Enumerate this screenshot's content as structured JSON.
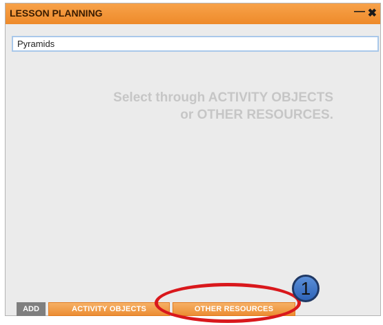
{
  "window": {
    "title": "LESSON PLANNING",
    "minimize_glyph": "—",
    "close_glyph": "✖"
  },
  "search": {
    "value": "Pyramids"
  },
  "main": {
    "message_line1": "Select through ACTIVITY OBJECTS",
    "message_line2": "or OTHER RESOURCES."
  },
  "footer": {
    "add_label": "ADD",
    "activity_objects_label": "ACTIVITY OBJECTS",
    "other_resources_label": "OTHER RESOURCES"
  },
  "annotation": {
    "callout_number": "1"
  },
  "colors": {
    "titlebar": "#ee8a2a",
    "panel_background": "#ebebeb",
    "highlight": "#d9181c",
    "callout": "#3a72c8"
  }
}
